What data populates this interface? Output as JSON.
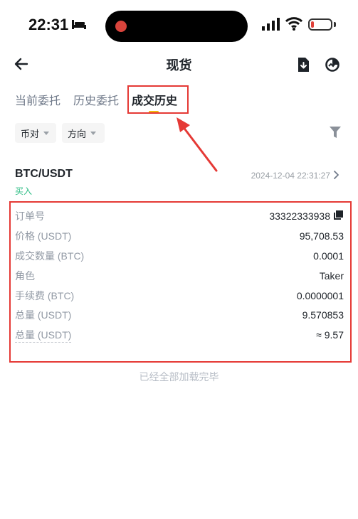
{
  "status_bar": {
    "time": "22:31"
  },
  "nav": {
    "title": "现货"
  },
  "tabs": [
    {
      "label": "当前委托",
      "active": false
    },
    {
      "label": "历史委托",
      "active": false
    },
    {
      "label": "成交历史",
      "active": true
    }
  ],
  "filters": {
    "pair_label": "币对",
    "direction_label": "方向"
  },
  "trade": {
    "pair": "BTC/USDT",
    "side": "买入",
    "datetime": "2024-12-04 22:31:27",
    "rows": [
      {
        "label": "订单号",
        "value": "33322333938"
      },
      {
        "label": "价格 (USDT)",
        "value": "95,708.53"
      },
      {
        "label": "成交数量 (BTC)",
        "value": "0.0001"
      },
      {
        "label": "角色",
        "value": "Taker"
      },
      {
        "label": "手续费 (BTC)",
        "value": "0.0000001"
      },
      {
        "label": "总量 (USDT)",
        "value": "9.570853"
      },
      {
        "label": "总量 (USDT)",
        "value": "≈ 9.57"
      }
    ]
  },
  "footer_text": "已经全部加载完毕",
  "colors": {
    "accent": "#f0b90b",
    "buy": "#2ebd85",
    "annotation": "#e53935"
  }
}
